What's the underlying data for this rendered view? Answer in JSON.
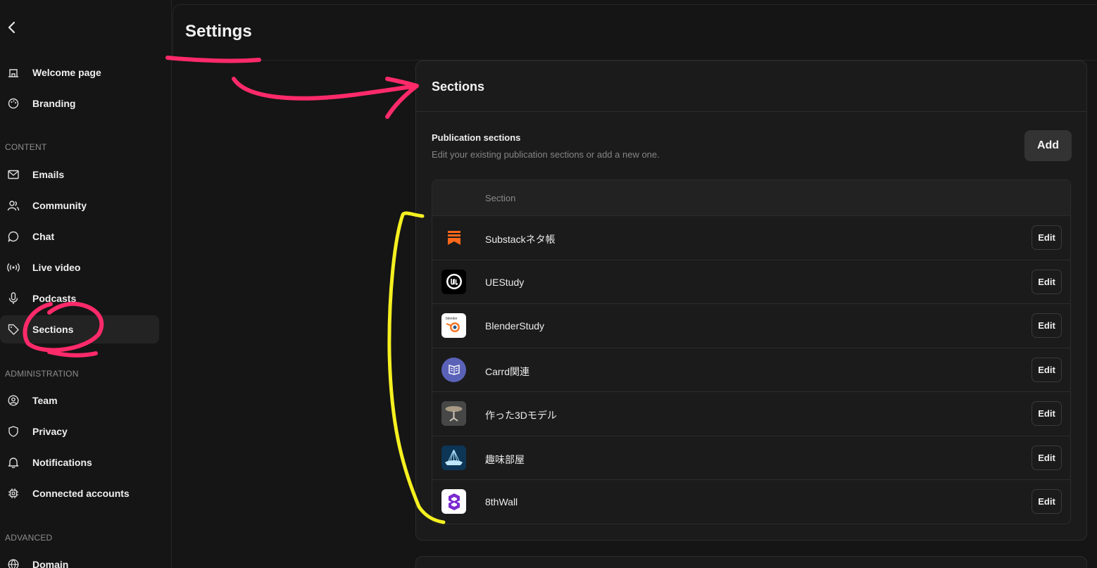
{
  "page": {
    "title": "Settings"
  },
  "sidebar": {
    "back_icon": "chevron-left-icon",
    "items_top": [
      {
        "label": "Welcome page",
        "icon": "home-icon"
      },
      {
        "label": "Branding",
        "icon": "palette-icon"
      }
    ],
    "content_header": "CONTENT",
    "content_items": [
      {
        "label": "Emails",
        "icon": "mail-icon"
      },
      {
        "label": "Community",
        "icon": "users-icon"
      },
      {
        "label": "Chat",
        "icon": "chat-icon"
      },
      {
        "label": "Live video",
        "icon": "broadcast-icon"
      },
      {
        "label": "Podcasts",
        "icon": "microphone-icon"
      },
      {
        "label": "Sections",
        "icon": "tag-icon",
        "active": true
      }
    ],
    "admin_header": "ADMINISTRATION",
    "admin_items": [
      {
        "label": "Team",
        "icon": "user-circle-icon"
      },
      {
        "label": "Privacy",
        "icon": "shield-icon"
      },
      {
        "label": "Notifications",
        "icon": "bell-icon"
      },
      {
        "label": "Connected accounts",
        "icon": "chip-icon"
      }
    ],
    "advanced_header": "ADVANCED",
    "advanced_items": [
      {
        "label": "Domain",
        "icon": "globe-icon"
      }
    ]
  },
  "sections_card": {
    "title": "Sections",
    "pub_title": "Publication sections",
    "pub_desc": "Edit your existing publication sections or add a new one.",
    "add_label": "Add",
    "table_header": "Section",
    "edit_label": "Edit",
    "rows": [
      {
        "name": "Substackネタ帳",
        "icon": "substack-logo-icon"
      },
      {
        "name": "UEStudy",
        "icon": "unreal-logo-icon"
      },
      {
        "name": "BlenderStudy",
        "icon": "blender-logo-icon"
      },
      {
        "name": "Carrd関連",
        "icon": "carrd-logo-icon"
      },
      {
        "name": "作った3Dモデル",
        "icon": "table-model-thumbnail"
      },
      {
        "name": "趣味部屋",
        "icon": "hobby-thumbnail"
      },
      {
        "name": "8thWall",
        "icon": "8thwall-logo-icon"
      }
    ]
  },
  "colors": {
    "background": "#151515",
    "card": "#1b1b1b",
    "annotation_pink": "#ff2a6a",
    "annotation_yellow": "#f5f020"
  }
}
